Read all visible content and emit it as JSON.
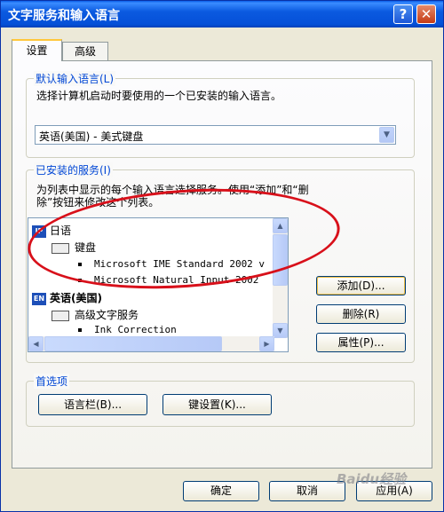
{
  "window": {
    "title": "文字服务和输入语言"
  },
  "titlebar_buttons": {
    "help": "?",
    "close": "✕"
  },
  "tabs": [
    {
      "label": "设置"
    },
    {
      "label": "高级"
    }
  ],
  "default_lang": {
    "legend": "默认输入语言(L)",
    "desc": "选择计算机启动时要使用的一个已安装的输入语言。",
    "selected": "英语(美国) - 美式键盘"
  },
  "installed": {
    "legend": "已安装的服务(I)",
    "desc_line1": "为列表中显示的每个输入语言选择服务。使用“添加”和“删",
    "desc_line2": "除”按钮来修改这个列表。",
    "tree": {
      "jp_badge": "JP",
      "jp_lang": "日语",
      "jp_keyboard": "键盘",
      "jp_item1": "Microsoft IME Standard 2002 v",
      "jp_item2": "Microsoft Natural Input 2002",
      "en_badge": "EN",
      "en_lang": "英语(美国)",
      "en_adv": "高级文字服务",
      "en_item1": "Ink Correction"
    }
  },
  "side_buttons": {
    "add": "添加(D)...",
    "remove": "删除(R)",
    "properties": "属性(P)..."
  },
  "prefs": {
    "legend": "首选项",
    "langbar": "语言栏(B)...",
    "keysettings": "键设置(K)..."
  },
  "footer": {
    "ok": "确定",
    "cancel": "取消",
    "apply": "应用(A)"
  },
  "watermark": "Baidu经验",
  "colors": {
    "title_bar": "#0554dc",
    "legend_text": "#0046d5",
    "annotation_oval": "#d8101a",
    "face": "#ece9d8"
  }
}
